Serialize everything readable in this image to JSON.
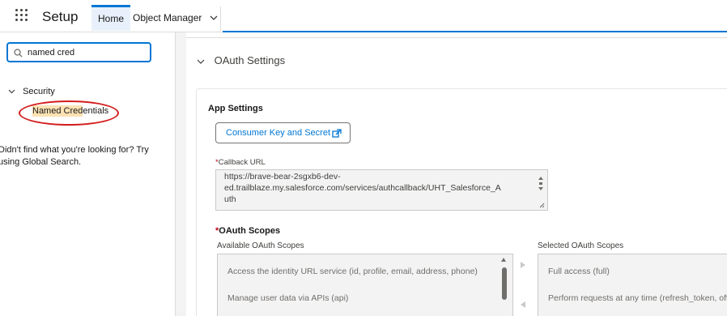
{
  "header": {
    "app_title": "Setup",
    "tabs": [
      {
        "label": "Home",
        "active": true
      },
      {
        "label": "Object Manager",
        "active": false
      }
    ],
    "accent_color": "#0176d3"
  },
  "sidebar": {
    "search": {
      "value": "named cred"
    },
    "tree": {
      "group_label": "Security",
      "item_label_highlight": "Named Cred",
      "item_label_rest": "entials"
    },
    "not_found_text": "Didn't find what you're looking for? Try using Global Search."
  },
  "main": {
    "section_title": "OAuth Settings",
    "app_settings_title": "App Settings",
    "consumer_button_label": "Consumer Key and Secret",
    "callback": {
      "required_mark": "*",
      "label": "Callback URL",
      "value": "https://brave-bear-2sgxb6-dev-\ned.trailblaze.my.salesforce.com/services/authcallback/UHT_Salesforce_A\nuth"
    },
    "scopes": {
      "required_mark": "*",
      "title": "OAuth Scopes",
      "available_label": "Available OAuth Scopes",
      "selected_label": "Selected OAuth Scopes",
      "available": [
        "Access the identity URL service (id, profile, email, address, phone)",
        "Manage user data via APIs (api)"
      ],
      "selected": [
        "Full access (full)",
        "Perform requests at any time (refresh_token, offline_access)"
      ]
    }
  }
}
